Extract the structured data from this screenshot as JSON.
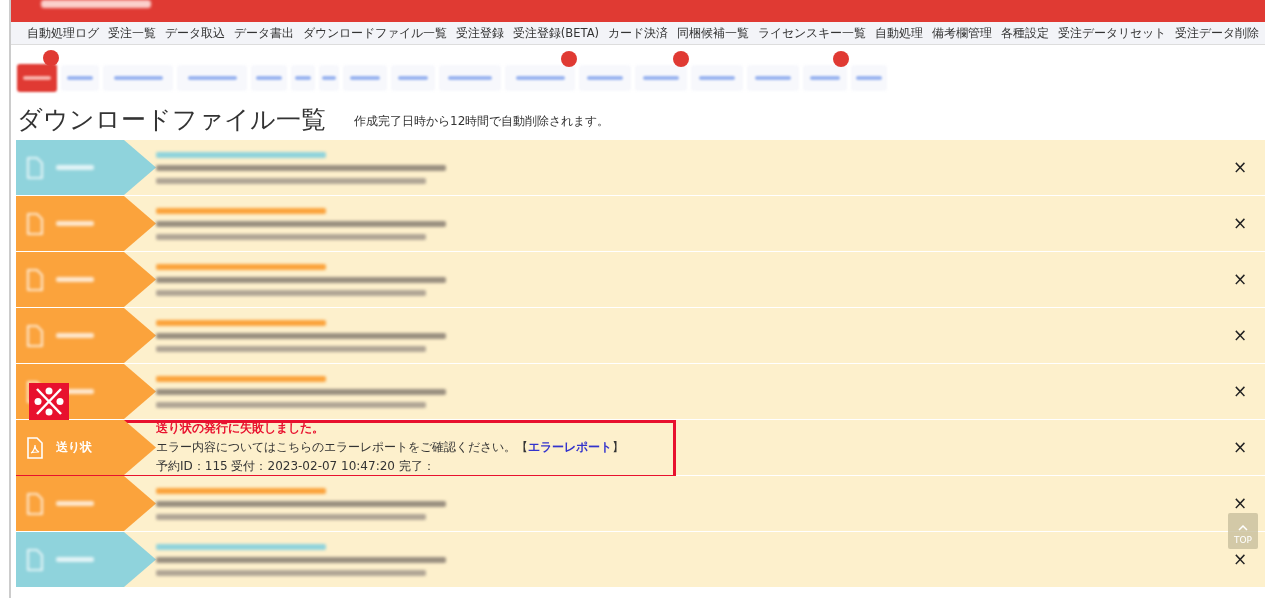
{
  "nav": {
    "items": [
      "自動処理ログ",
      "受注一覧",
      "データ取込",
      "データ書出",
      "ダウンロードファイル一覧",
      "受注登録",
      "受注登録(BETA)",
      "カード決済",
      "同梱候補一覧",
      "ライセンスキー一覧",
      "自動処理",
      "備考欄管理",
      "各種設定",
      "受注データリセット",
      "受注データ削除"
    ]
  },
  "page": {
    "title": "ダウンロードファイル一覧",
    "note": "作成完了日時から12時間で自動削除されます。"
  },
  "entries": [
    {
      "color": "#8fd3dc",
      "blurred": true,
      "highlighted": false,
      "close": "×"
    },
    {
      "color": "#fba33c",
      "blurred": true,
      "highlighted": false,
      "close": "×"
    },
    {
      "color": "#fba33c",
      "blurred": true,
      "highlighted": false,
      "close": "×"
    },
    {
      "color": "#fba33c",
      "blurred": true,
      "highlighted": false,
      "close": "×"
    },
    {
      "color": "#fba33c",
      "blurred": true,
      "highlighted": false,
      "close": "×"
    },
    {
      "color": "#fba33c",
      "blurred": false,
      "highlighted": true,
      "label": "送り状",
      "title": "送り状の発行に失敗しました。",
      "message": "エラー内容についてはこちらのエラーレポートをご確認ください。【",
      "link": "エラーレポート",
      "message_end": "】",
      "meta": "予約ID：115 受付：2023-02-07 10:47:20 完了：",
      "close": "×"
    },
    {
      "color": "#fba33c",
      "blurred": true,
      "highlighted": false,
      "close": "×"
    },
    {
      "color": "#8fd3dc",
      "blurred": true,
      "highlighted": false,
      "close": "×"
    }
  ],
  "top_button": {
    "label": "TOP"
  }
}
